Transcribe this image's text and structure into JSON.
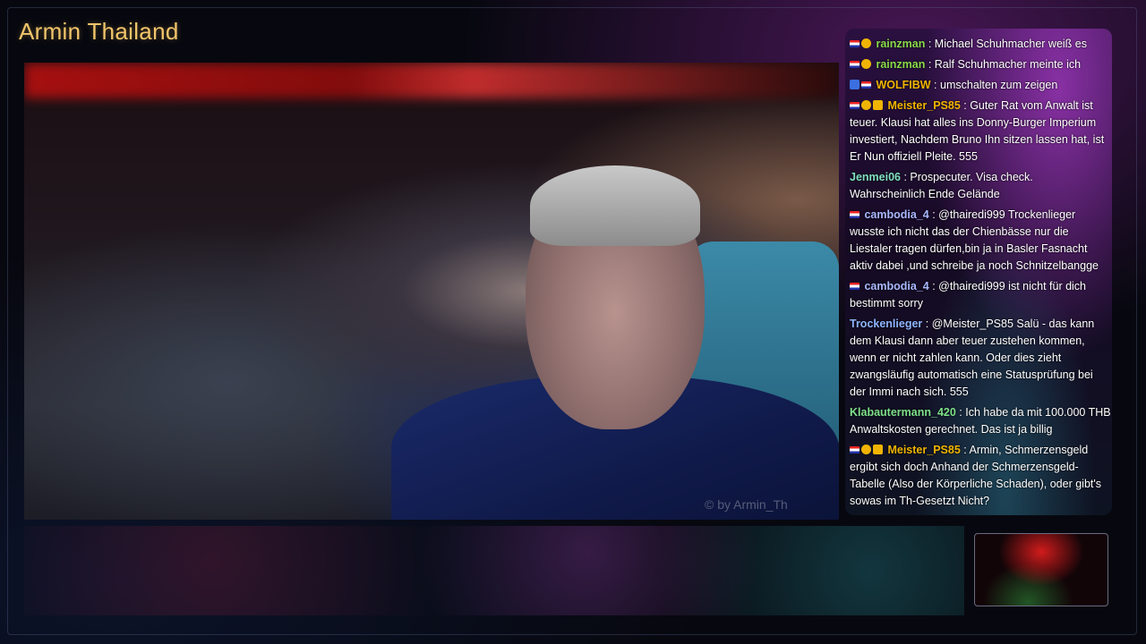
{
  "channel": {
    "title": "Armin Thailand"
  },
  "video": {
    "watermark": "© by Armin_Th"
  },
  "colors": {
    "title": "#f2c56a"
  },
  "chat": {
    "messages": [
      {
        "badges": [
          "flag",
          "alert"
        ],
        "user": "rainzman",
        "user_color": "#8ad94a",
        "text": "Michael Schuhmacher weiß es"
      },
      {
        "badges": [
          "flag",
          "alert"
        ],
        "user": "rainzman",
        "user_color": "#8ad94a",
        "text": "Ralf Schuhmacher meinte ich"
      },
      {
        "badges": [
          "blue",
          "flag"
        ],
        "user": "WOLFIBW",
        "user_color": "#f0b400",
        "text": "umschalten zum zeigen"
      },
      {
        "badges": [
          "flag",
          "alert",
          "sub"
        ],
        "user": "Meister_PS85",
        "user_color": "#f0b400",
        "text": "Guter Rat vom Anwalt ist teuer. Klausi hat alles ins Donny-Burger Imperium investiert, Nachdem Bruno Ihn sitzen lassen hat, ist Er Nun offiziell Pleite. 555"
      },
      {
        "badges": [],
        "user": "Jenmei06",
        "user_color": "#7fe0c0",
        "text": "Prospecuter. Visa check. Wahrscheinlich Ende Gelände"
      },
      {
        "badges": [
          "flag"
        ],
        "user": "cambodia_4",
        "user_color": "#a9b8ff",
        "text": "@thairedi999 Trockenlieger wusste ich nicht das der Chienbässe nur die Liestaler tragen dürfen,bin ja in Basler Fasnacht aktiv dabei ,und schreibe ja noch Schnitzelbangge"
      },
      {
        "badges": [
          "flag"
        ],
        "user": "cambodia_4",
        "user_color": "#a9b8ff",
        "text": "@thairedi999 ist nicht für dich bestimmt sorry"
      },
      {
        "badges": [],
        "user": "Trockenlieger",
        "user_color": "#8fb4ff",
        "text": "@Meister_PS85 Salü - das kann dem Klausi dann aber teuer zustehen kommen, wenn er nicht zahlen kann. Oder dies zieht zwangsläufig automatisch eine Statusprüfung bei der Immi nach sich. 555"
      },
      {
        "badges": [],
        "user": "Klabautermann_420",
        "user_color": "#7fe08a",
        "text": "Ich habe da mit 100.000 THB Anwaltskosten gerechnet. Das ist ja billig"
      },
      {
        "badges": [
          "flag",
          "alert",
          "sub"
        ],
        "user": "Meister_PS85",
        "user_color": "#f0b400",
        "text": "Armin, Schmerzensgeld ergibt sich doch Anhand der Schmerzensgeld-Tabelle (Also der Körperliche Schaden), oder gibt's sowas im Th-Gesetzt Nicht?"
      }
    ]
  }
}
